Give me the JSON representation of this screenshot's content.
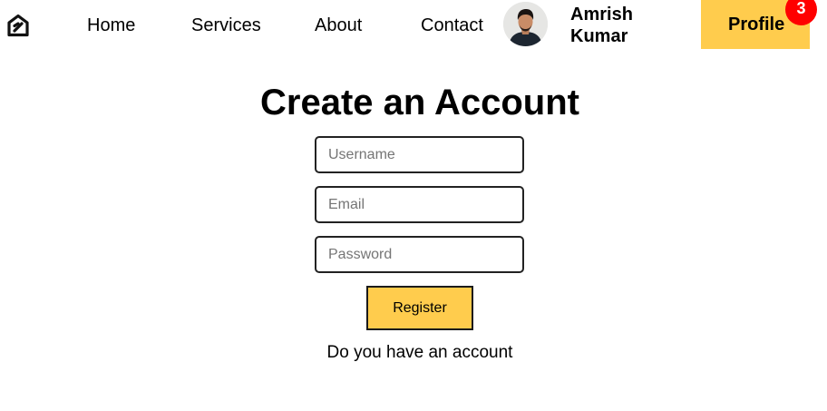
{
  "navbar": {
    "logo_icon": "house-logo-icon",
    "links": [
      {
        "label": "Home"
      },
      {
        "label": "Services"
      },
      {
        "label": "About"
      },
      {
        "label": "Contact"
      }
    ],
    "user": {
      "avatar_icon": "user-avatar",
      "first_name": "Amrish",
      "last_name": "Kumar"
    },
    "profile_button": {
      "label": "Profile",
      "notification_count": "3"
    }
  },
  "form": {
    "title": "Create an Account",
    "username": {
      "placeholder": "Username",
      "value": ""
    },
    "email": {
      "placeholder": "Email",
      "value": ""
    },
    "password": {
      "placeholder": "Password",
      "value": ""
    },
    "register_label": "Register",
    "login_prompt": "Do you have an account"
  },
  "colors": {
    "accent": "#ffcc4d",
    "badge": "#ff0000",
    "text": "#000000",
    "input_border": "#222222",
    "placeholder": "#757575"
  }
}
